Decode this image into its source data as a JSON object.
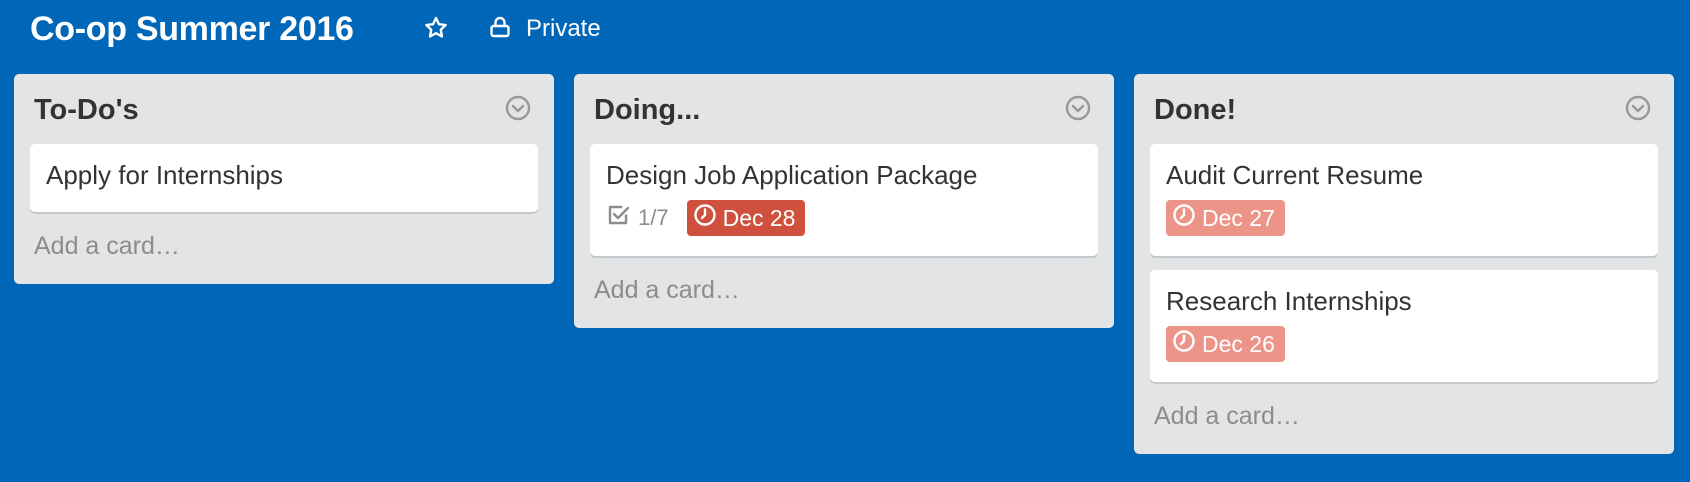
{
  "board": {
    "title": "Co-op Summer 2016",
    "visibility": "Private"
  },
  "icons": {
    "star": "star-icon",
    "lock": "lock-icon",
    "list_menu": "chevron-down-circle-icon",
    "checklist": "checkbox-icon",
    "due": "clock-icon"
  },
  "colors": {
    "board_background": "#0067b8",
    "list_background": "#e2e4e6",
    "due_overdue": "#cf513d",
    "due_complete": "#ec9488"
  },
  "lists": [
    {
      "title": "To-Do's",
      "add_card": "Add a card…",
      "cards": [
        {
          "title": "Apply for Internships"
        }
      ]
    },
    {
      "title": "Doing...",
      "add_card": "Add a card…",
      "cards": [
        {
          "title": "Design Job Application Package",
          "checklist": "1/7",
          "due": "Dec 28"
        }
      ]
    },
    {
      "title": "Done!",
      "add_card": "Add a card…",
      "cards": [
        {
          "title": "Audit Current Resume",
          "due": "Dec 27"
        },
        {
          "title": "Research Internships",
          "due": "Dec 26"
        }
      ]
    }
  ]
}
